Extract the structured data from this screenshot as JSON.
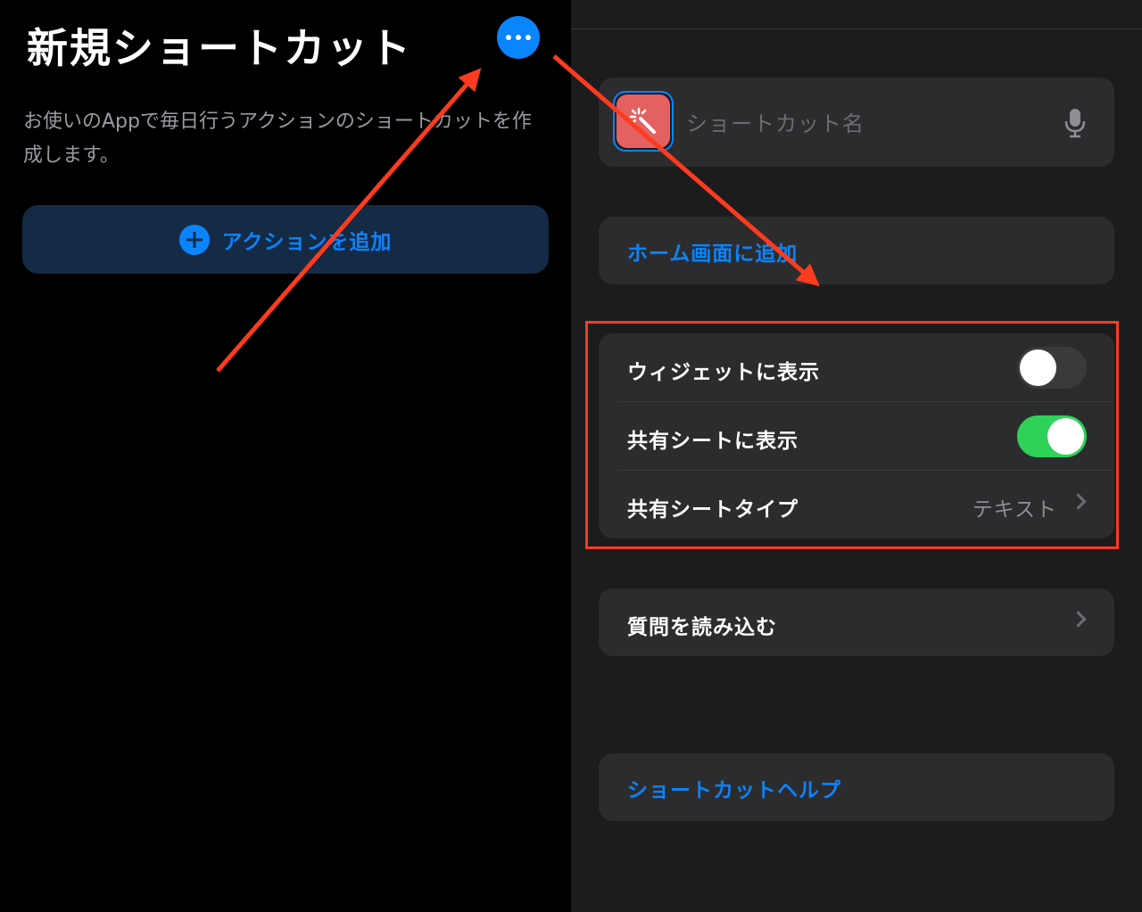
{
  "left": {
    "title": "新規ショートカット",
    "description": "お使いのAppで毎日行うアクションのショートカットを作成します。",
    "add_action_label": "アクションを追加"
  },
  "details": {
    "name_placeholder": "ショートカット名",
    "add_to_home": "ホーム画面に追加",
    "show_in_widget": {
      "label": "ウィジェットに表示",
      "enabled": false
    },
    "show_in_share_sheet": {
      "label": "共有シートに表示",
      "enabled": true
    },
    "share_sheet_type": {
      "label": "共有シートタイプ",
      "value": "テキスト"
    },
    "import_questions": "質問を読み込む",
    "help": "ショートカットヘルプ"
  },
  "colors": {
    "accent": "#0a84ff",
    "toggle_on": "#30d158",
    "annotation": "#ff3b1f",
    "icon_bg": "#e56161"
  },
  "icons": [
    "ellipsis-icon",
    "plus-circle-icon",
    "magic-wand-icon",
    "microphone-icon",
    "chevron-right-icon"
  ]
}
